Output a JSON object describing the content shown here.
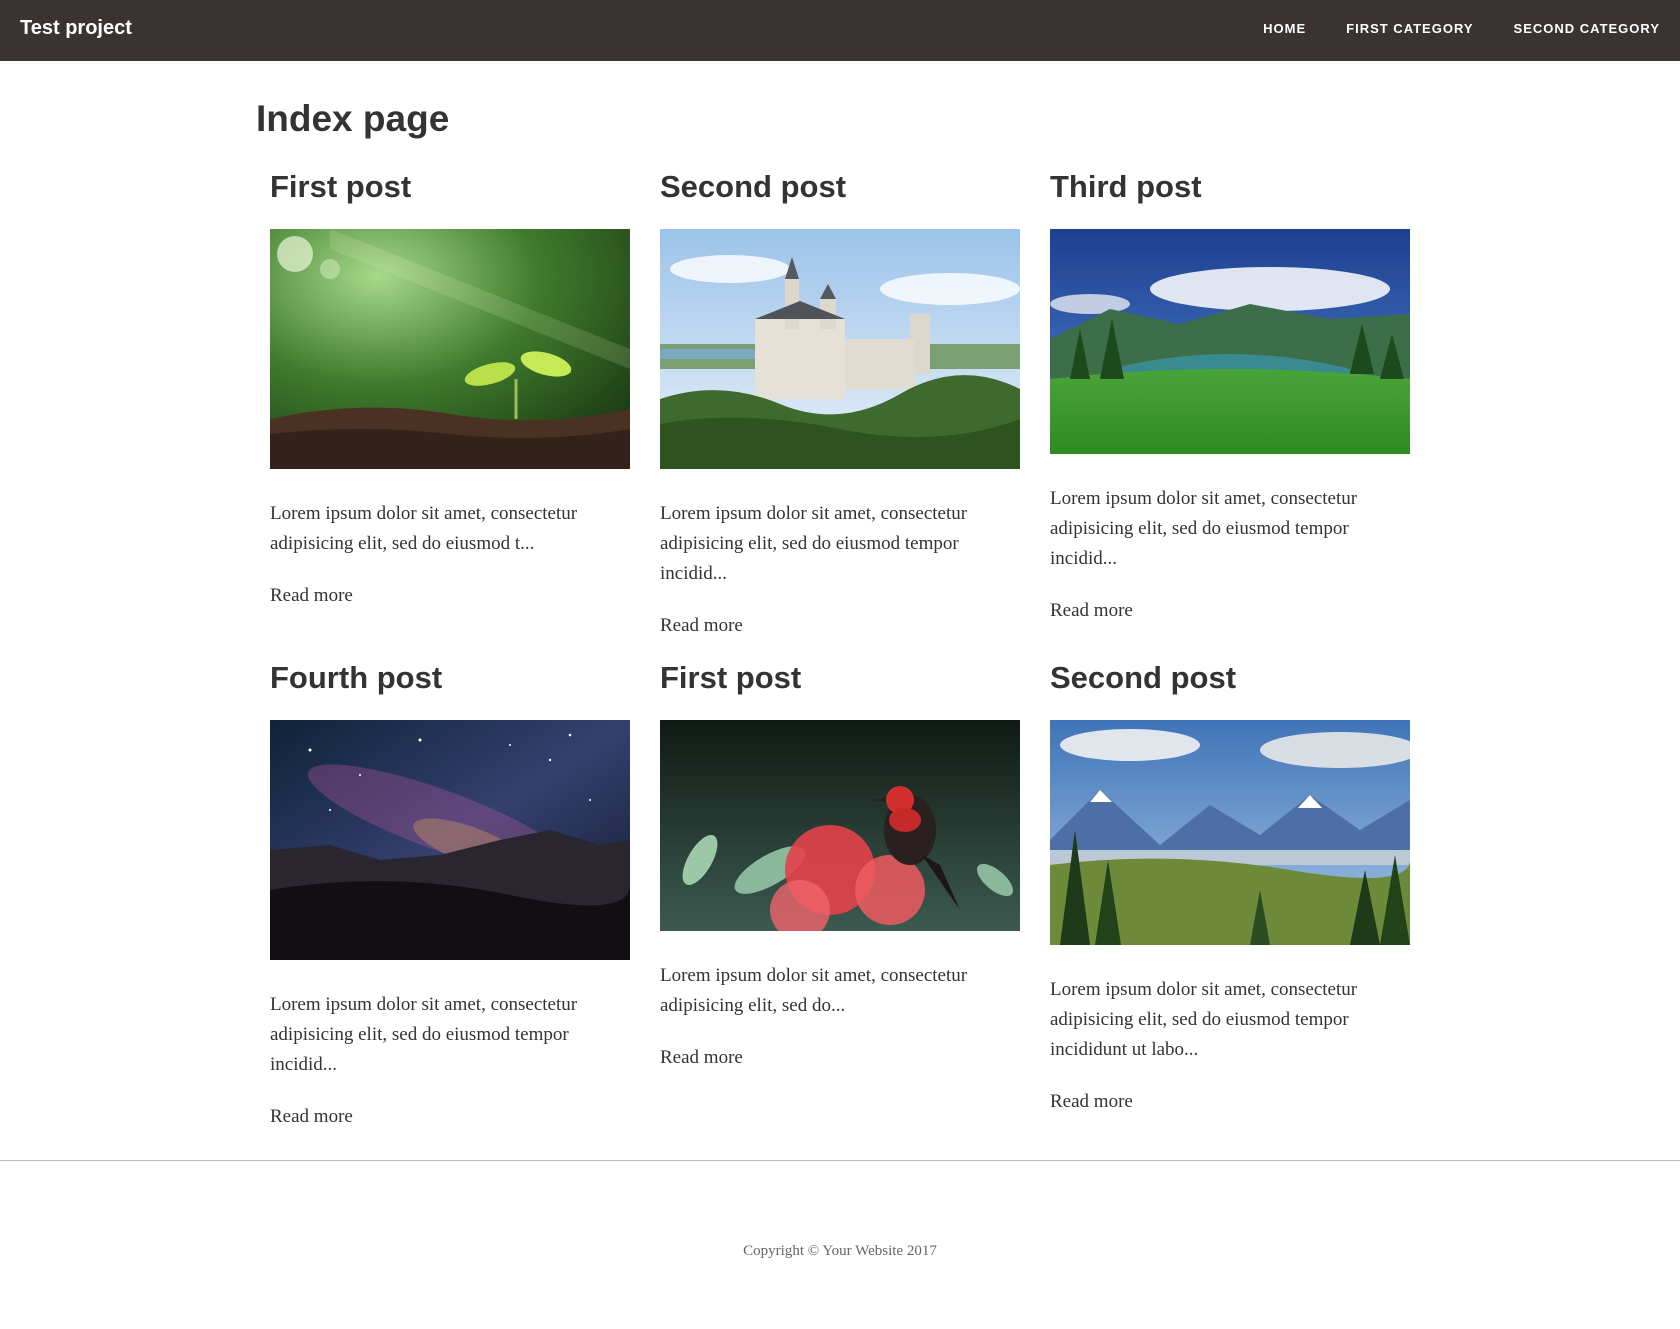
{
  "navbar": {
    "brand": "Test project",
    "links": [
      "HOME",
      "FIRST CATEGORY",
      "SECOND CATEGORY"
    ]
  },
  "page": {
    "title": "Index page"
  },
  "posts": [
    {
      "title": "First post",
      "excerpt": "Lorem ipsum dolor sit amet, consectetur adipisicing elit, sed do eiusmod t...",
      "read_more": "Read more",
      "image": "seedling-photo"
    },
    {
      "title": "Second post",
      "excerpt": "Lorem ipsum dolor sit amet, consectetur adipisicing elit, sed do eiusmod tempor incidid...",
      "read_more": "Read more",
      "image": "castle-photo"
    },
    {
      "title": "Third post",
      "excerpt": "Lorem ipsum dolor sit amet, consectetur adipisicing elit, sed do eiusmod tempor incidid...",
      "read_more": "Read more",
      "image": "mountain-meadow-photo"
    },
    {
      "title": "Fourth post",
      "excerpt": "Lorem ipsum dolor sit amet, consectetur adipisicing elit, sed do eiusmod tempor incidid...",
      "read_more": "Read more",
      "image": "night-sky-photo"
    },
    {
      "title": "First post",
      "excerpt": "Lorem ipsum dolor sit amet, consectetur adipisicing elit, sed do...",
      "read_more": "Read more",
      "image": "bird-flower-photo"
    },
    {
      "title": "Second post",
      "excerpt": "Lorem ipsum dolor sit amet, consectetur adipisicing elit, sed do eiusmod tempor incididunt ut labo...",
      "read_more": "Read more",
      "image": "mountain-valley-photo"
    }
  ],
  "footer": {
    "copyright": "Copyright © Your Website 2017"
  }
}
